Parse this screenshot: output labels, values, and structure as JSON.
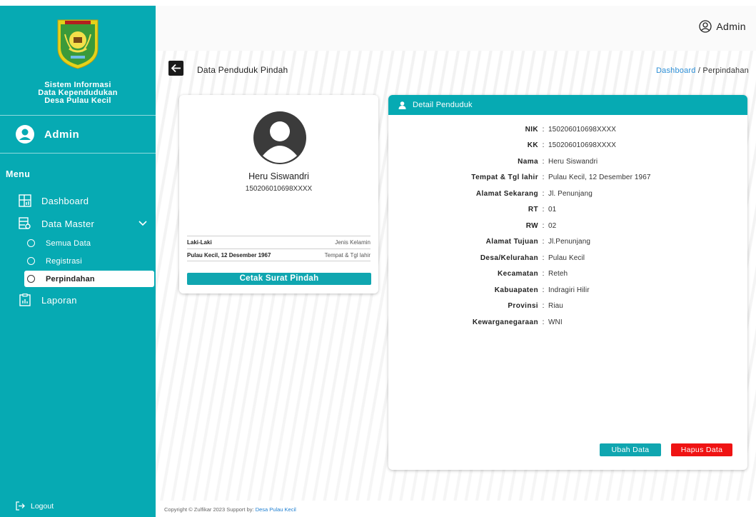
{
  "sidebar": {
    "app_title_lines": [
      "Sistem Informasi",
      "Data Kependudukan",
      "Desa Pulau Kecil"
    ],
    "user_name": "Admin",
    "menu_heading": "Menu",
    "items": {
      "dashboard": "Dashboard",
      "data_master": "Data Master",
      "laporan": "Laporan"
    },
    "subitems": {
      "semua_data": "Semua Data",
      "registrasi": "Registrasi",
      "perpindahan": "Perpindahan"
    },
    "logout": "Logout"
  },
  "topbar": {
    "user_label": "Admin"
  },
  "page": {
    "title": "Data Penduduk Pindah",
    "breadcrumb_link": "Dashboard",
    "breadcrumb_sep": " / ",
    "breadcrumb_current": "Perpindahan"
  },
  "profile": {
    "name": "Heru Siswandri",
    "nik": "150206010698XXXX",
    "rows": [
      {
        "value": "Laki-Laki",
        "key": "Jenis Kelamin"
      },
      {
        "value": "Pulau Kecil, 12 Desember 1967",
        "key": "Tempat & Tgl lahir"
      }
    ],
    "print_button": "Cetak Surat Pindah"
  },
  "detail": {
    "header": "Detail Penduduk",
    "fields": [
      {
        "label": "NIK",
        "value": "150206010698XXXX"
      },
      {
        "label": "KK",
        "value": "150206010698XXXX"
      },
      {
        "label": "Nama",
        "value": "Heru Siswandri"
      },
      {
        "label": "Tempat & Tgl lahir",
        "value": "Pulau Kecil, 12 Desember 1967"
      },
      {
        "label": "Alamat Sekarang",
        "value": "Jl. Penunjang"
      },
      {
        "label": "RT",
        "value": "01"
      },
      {
        "label": "RW",
        "value": "02"
      },
      {
        "label": "Alamat Tujuan",
        "value": "Jl.Penunjang"
      },
      {
        "label": "Desa/Kelurahan",
        "value": "Pulau Kecil"
      },
      {
        "label": "Kecamatan",
        "value": "Reteh"
      },
      {
        "label": "Kabuapaten",
        "value": "Indragiri Hilir"
      },
      {
        "label": "Provinsi",
        "value": "Riau"
      },
      {
        "label": "Kewarganegaraan",
        "value": "WNI"
      }
    ],
    "colon": ":",
    "edit_button": "Ubah Data",
    "delete_button": "Hapus Data"
  },
  "footer": {
    "text": "Copyright © Zulfikar 2023 Support by: ",
    "link": "Desa Pulau Kecil"
  },
  "colors": {
    "accent": "#06aab3",
    "danger": "#ef1313",
    "link": "#2b8ed6"
  }
}
